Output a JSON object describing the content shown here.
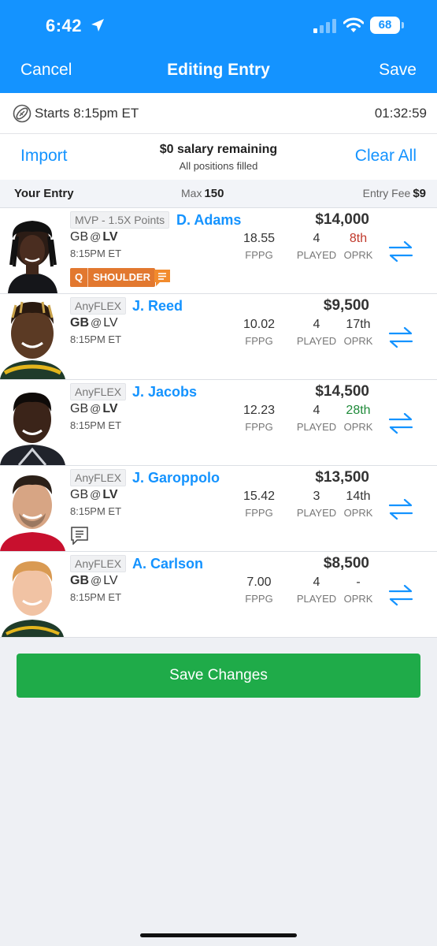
{
  "status_bar": {
    "time": "6:42",
    "battery": "68"
  },
  "nav": {
    "cancel": "Cancel",
    "title": "Editing Entry",
    "save": "Save"
  },
  "starts": {
    "text": "Starts 8:15pm ET",
    "countdown": "01:32:59"
  },
  "salary": {
    "import": "Import",
    "remaining": "$0 salary remaining",
    "filled": "All positions filled",
    "clear_all": "Clear All"
  },
  "entry_header": {
    "your_entry": "Your Entry",
    "max_label": "Max",
    "max_value": "150",
    "fee_label": "Entry Fee",
    "fee_value": "$9"
  },
  "players": [
    {
      "slot": "MVP - 1.5X Points",
      "name": "D. Adams",
      "salary": "$14,000",
      "team": "GB",
      "at": "@",
      "opp": "LV",
      "bold": "opp",
      "time": "8:15PM ET",
      "fppg": "18.55",
      "fppg_label": "FPPG",
      "played": "4",
      "played_label": "PLAYED",
      "oprk": "8th",
      "oprk_label": "OPRK",
      "oprk_color": "#c0392b",
      "injury_status": "Q",
      "injury": "SHOULDER",
      "note": "orange"
    },
    {
      "slot": "AnyFLEX",
      "name": "J. Reed",
      "salary": "$9,500",
      "team": "GB",
      "at": "@",
      "opp": "LV",
      "bold": "team",
      "time": "8:15PM ET",
      "fppg": "10.02",
      "fppg_label": "FPPG",
      "played": "4",
      "played_label": "PLAYED",
      "oprk": "17th",
      "oprk_label": "OPRK",
      "oprk_color": "#333333"
    },
    {
      "slot": "AnyFLEX",
      "name": "J. Jacobs",
      "salary": "$14,500",
      "team": "GB",
      "at": "@",
      "opp": "LV",
      "bold": "opp",
      "time": "8:15PM ET",
      "fppg": "12.23",
      "fppg_label": "FPPG",
      "played": "4",
      "played_label": "PLAYED",
      "oprk": "28th",
      "oprk_label": "OPRK",
      "oprk_color": "#1f8a3a"
    },
    {
      "slot": "AnyFLEX",
      "name": "J. Garoppolo",
      "salary": "$13,500",
      "team": "GB",
      "at": "@",
      "opp": "LV",
      "bold": "opp",
      "time": "8:15PM ET",
      "fppg": "15.42",
      "fppg_label": "FPPG",
      "played": "3",
      "played_label": "PLAYED",
      "oprk": "14th",
      "oprk_label": "OPRK",
      "oprk_color": "#333333",
      "note": "gray"
    },
    {
      "slot": "AnyFLEX",
      "name": "A. Carlson",
      "salary": "$8,500",
      "team": "GB",
      "at": "@",
      "opp": "LV",
      "bold": "team",
      "time": "8:15PM ET",
      "fppg": "7.00",
      "fppg_label": "FPPG",
      "played": "4",
      "played_label": "PLAYED",
      "oprk": "-",
      "oprk_label": "OPRK",
      "oprk_color": "#333333"
    }
  ],
  "save_changes": "Save Changes",
  "colors": {
    "brand_blue": "#1493ff",
    "save_green": "#1fab49",
    "injury_orange": "#e2782f"
  }
}
